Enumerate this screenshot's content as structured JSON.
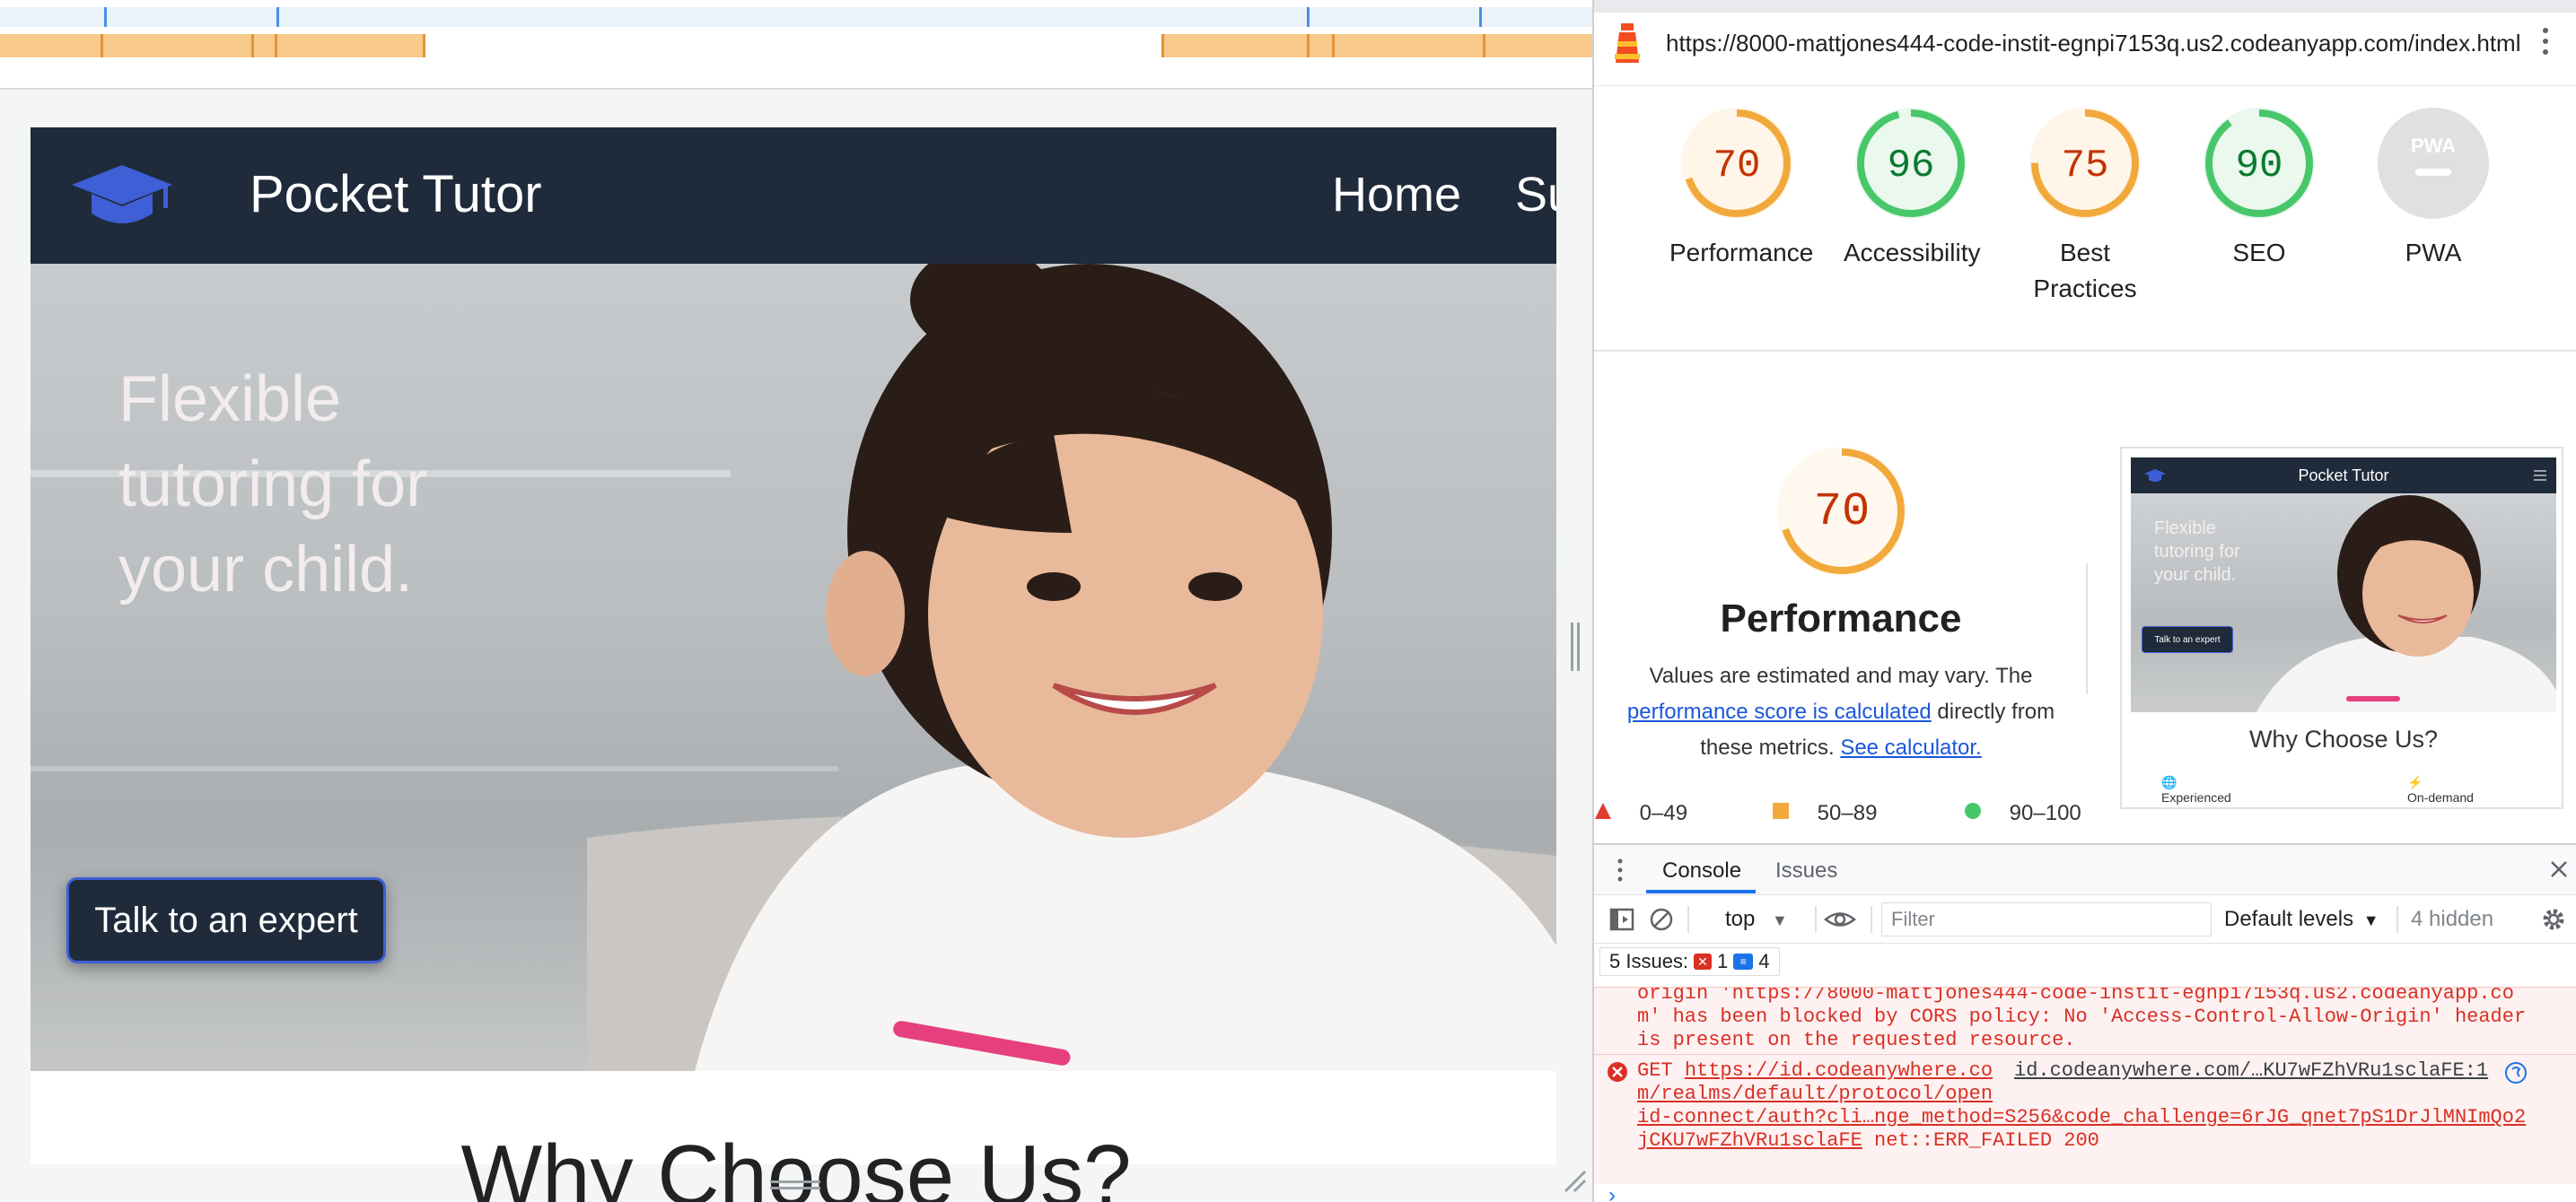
{
  "site": {
    "brand": "Pocket Tutor",
    "nav": {
      "home": "Home",
      "partial": "Su"
    },
    "hero_title": "Flexible tutoring for your child.",
    "hero_button": "Talk to an expert",
    "why_partial": "Why Choose Us?"
  },
  "devtools": {
    "url": "https://8000-mattjones444-code-instit-egnpi7153q.us2.codeanyapp.com/index.html",
    "scores": [
      {
        "label": "Performance",
        "value": "70",
        "score": 70,
        "color": "#f2a93b",
        "text_color": "#c33300"
      },
      {
        "label": "Accessibility",
        "value": "96",
        "score": 96,
        "color": "#47c769",
        "text_color": "#0a7a2f"
      },
      {
        "label": "Best Practices",
        "value": "75",
        "score": 75,
        "color": "#f2a93b",
        "text_color": "#c33300"
      },
      {
        "label": "SEO",
        "value": "90",
        "score": 90,
        "color": "#47c769",
        "text_color": "#0a7a2f"
      },
      {
        "label": "PWA",
        "value": "PWA",
        "score": null,
        "color": "#e0e0e0",
        "text_color": "#ffffff"
      }
    ],
    "perf": {
      "value": "70",
      "title": "Performance",
      "desc_1": "Values are estimated and may vary. The",
      "link_1": "performance score is calculated",
      "desc_2": "directly from",
      "desc_3": "these metrics.",
      "link_2": "See calculator."
    },
    "legend": [
      {
        "range": "0–49",
        "color": "#e33b2e",
        "shape": "triangle"
      },
      {
        "range": "50–89",
        "color": "#f2a93b",
        "shape": "square"
      },
      {
        "range": "90–100",
        "color": "#47c769",
        "shape": "circle"
      }
    ],
    "thumb": {
      "title": "Pocket Tutor",
      "hero": "Flexible tutoring for your child.",
      "button": "Talk to an expert",
      "why": "Why Choose Us?",
      "f1": "Experienced",
      "f2": "On-demand"
    },
    "drawer": {
      "tab_console": "Console",
      "tab_issues": "Issues",
      "context": "top",
      "filter_placeholder": "Filter",
      "levels": "Default levels",
      "hidden": "4 hidden",
      "issues_label": "5 Issues:",
      "issues_errors": "1",
      "issues_info": "4",
      "log_1_l1": "origin 'https://8000-mattjones444-code-instit-egnpi7153q.us2.codeanyapp.co",
      "log_1_l2": "m' has been blocked by CORS policy: No 'Access-Control-Allow-Origin' header",
      "log_1_l3": "is present on the requested resource.",
      "log_2_method": "GET",
      "log_2_url_l1": "https://id.codeanywhere.co",
      "log_2_src": "id.codeanywhere.com/…KU7wFZhVRu1sclaFE:1",
      "log_2_url_l2": "m/realms/default/protocol/open",
      "log_2_url_l3": "id-connect/auth?cli…nge_method=S256&code_challenge=6rJG_qnet7pS1DrJlMNImQo2",
      "log_2_url_l4": "jCKU7wFZhVRu1sclaFE",
      "log_2_status": "net::ERR_FAILED 200",
      "prompt": "›"
    }
  }
}
